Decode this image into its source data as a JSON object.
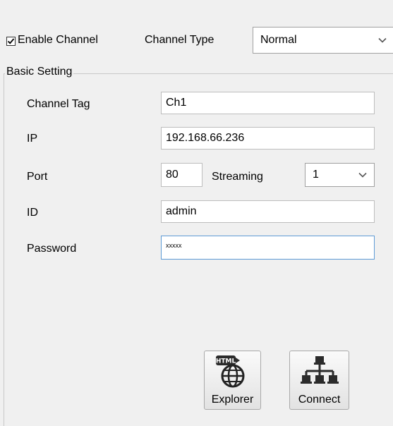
{
  "channel": {
    "enable_label": "Enable Channel",
    "enable_checked": true,
    "type_label": "Channel Type",
    "type_value": "Normal"
  },
  "basic": {
    "title": "Basic Setting",
    "tag_label": "Channel Tag",
    "tag_value": "Ch1",
    "ip_label": "IP",
    "ip_value": "192.168.66.236",
    "port_label": "Port",
    "port_value": "80",
    "streaming_label": "Streaming",
    "streaming_value": "1",
    "id_label": "ID",
    "id_value": "admin",
    "password_label": "Password",
    "password_value": "xxxxx"
  },
  "buttons": {
    "explorer_label": "Explorer",
    "explorer_badge": "HTML",
    "connect_label": "Connect"
  },
  "icons": {
    "checkbox": "checkmark-icon",
    "dropdown": "chevron-down-icon",
    "explorer": "globe-html-icon",
    "connect": "network-icon"
  }
}
